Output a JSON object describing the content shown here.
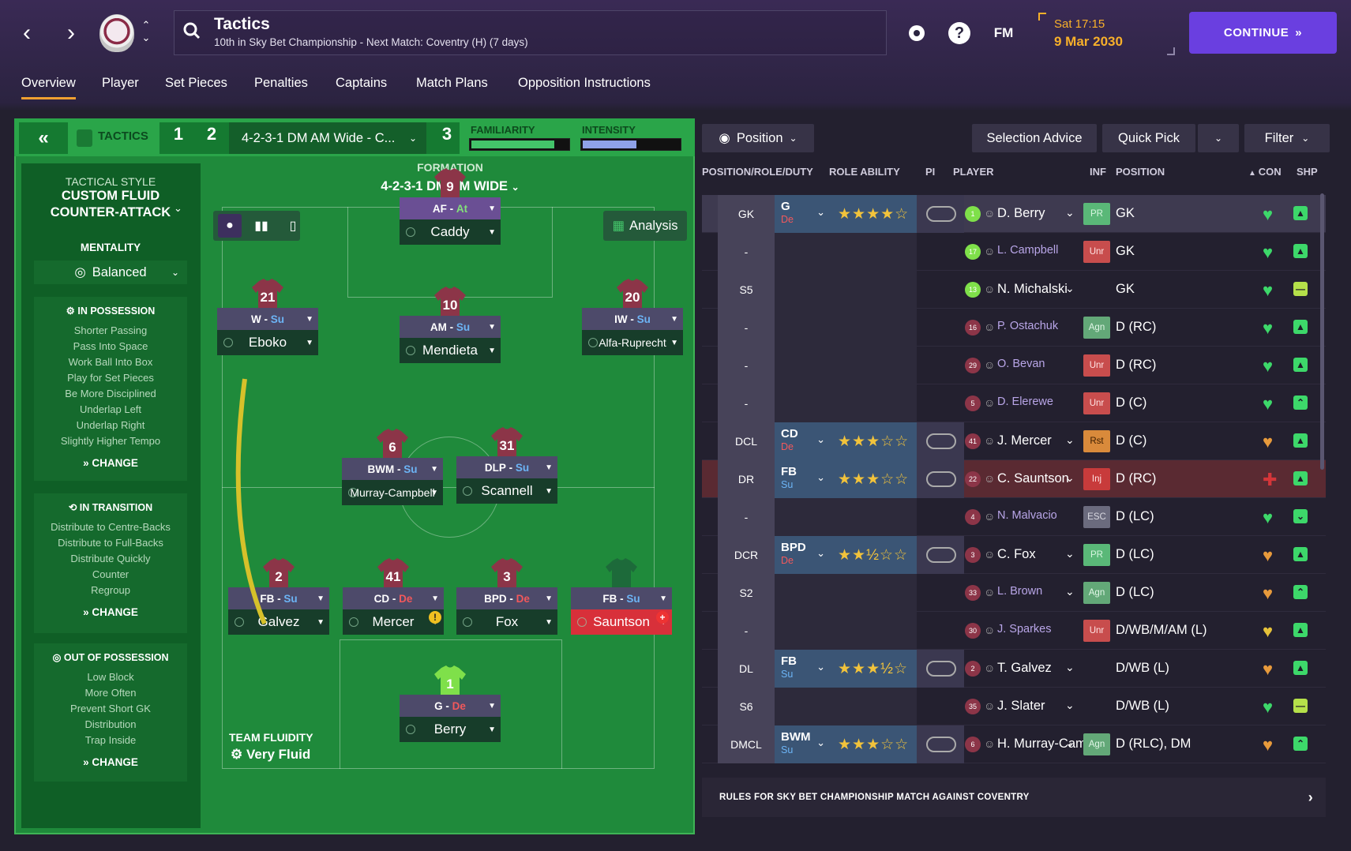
{
  "header": {
    "title": "Tactics",
    "subtitle": "10th in Sky Bet Championship - Next Match: Coventry (H) (7 days)",
    "fm_label": "FM",
    "time": "Sat 17:15",
    "date": "9 Mar 2030",
    "continue_label": "CONTINUE"
  },
  "tabs": [
    "Overview",
    "Player",
    "Set Pieces",
    "Penalties",
    "Captains",
    "Match Plans",
    "Opposition Instructions"
  ],
  "tactics_bar": {
    "label": "TACTICS",
    "slot1": "1",
    "slot2": "2",
    "slot3": "3",
    "formation_select": "4-2-3-1 DM AM Wide - C...",
    "familiarity_label": "FAMILIARITY",
    "intensity_label": "INTENSITY",
    "familiarity": 0.85,
    "intensity": 0.55
  },
  "sidebar": {
    "style_label": "TACTICAL STYLE",
    "style_value_1": "CUSTOM FLUID",
    "style_value_2": "COUNTER-ATTACK",
    "mentality_label": "MENTALITY",
    "mentality_value": "Balanced",
    "in_possession": {
      "title": "IN POSSESSION",
      "items": [
        "Shorter Passing",
        "Pass Into Space",
        "Work Ball Into Box",
        "Play for Set Pieces",
        "Be More Disciplined",
        "Underlap Left",
        "Underlap Right",
        "Slightly Higher Tempo"
      ],
      "change": "CHANGE"
    },
    "in_transition": {
      "title": "IN TRANSITION",
      "items": [
        "Distribute to Centre-Backs",
        "Distribute to Full-Backs",
        "Distribute Quickly",
        "Counter",
        "Regroup"
      ],
      "change": "CHANGE"
    },
    "out_of_possession": {
      "title": "OUT OF POSSESSION",
      "items": [
        "Low Block",
        "More Often",
        "Prevent Short GK",
        "Distribution",
        "Trap Inside"
      ],
      "change": "CHANGE"
    }
  },
  "pitch": {
    "formation_label": "FORMATION",
    "formation_value": "4-2-3-1 DM AM WIDE",
    "analysis_label": "Analysis",
    "fluidity_label": "TEAM FLUIDITY",
    "fluidity_value": "Very Fluid",
    "players": [
      {
        "id": "af",
        "num": "9",
        "role": "AF",
        "duty": "At",
        "name": "Caddy"
      },
      {
        "id": "w",
        "num": "21",
        "role": "W",
        "duty": "Su",
        "name": "Eboko"
      },
      {
        "id": "am",
        "num": "10",
        "role": "AM",
        "duty": "Su",
        "name": "Mendieta"
      },
      {
        "id": "iw",
        "num": "20",
        "role": "IW",
        "duty": "Su",
        "name": "Alfa-Ruprecht"
      },
      {
        "id": "bwm",
        "num": "6",
        "role": "BWM",
        "duty": "Su",
        "name": "Murray-Campbell"
      },
      {
        "id": "dlp",
        "num": "31",
        "role": "DLP",
        "duty": "Su",
        "name": "Scannell"
      },
      {
        "id": "fbl",
        "num": "2",
        "role": "FB",
        "duty": "Su",
        "name": "Galvez"
      },
      {
        "id": "cd",
        "num": "41",
        "role": "CD",
        "duty": "De",
        "name": "Mercer"
      },
      {
        "id": "bpd",
        "num": "3",
        "role": "BPD",
        "duty": "De",
        "name": "Fox"
      },
      {
        "id": "fbr",
        "num": "",
        "role": "FB",
        "duty": "Su",
        "name": "Sauntson"
      },
      {
        "id": "gk",
        "num": "1",
        "role": "G",
        "duty": "De",
        "name": "Berry"
      }
    ]
  },
  "list": {
    "position_filter": "Position",
    "selection_advice": "Selection Advice",
    "quick_pick": "Quick Pick",
    "filter": "Filter",
    "columns": {
      "pos_role_duty": "POSITION/ROLE/DUTY",
      "role_ability": "ROLE ABILITY",
      "pi": "PI",
      "player": "PLAYER",
      "inf": "INF",
      "position": "POSITION",
      "con": "CON",
      "shp": "SHP"
    },
    "rows": [
      {
        "slot": "GK",
        "role": "G",
        "duty": "De",
        "stars": "★★★★☆",
        "num": "1",
        "player": "D. Berry",
        "inf": "PR",
        "position": "GK",
        "heart": "green",
        "shp": "up"
      },
      {
        "slot": "-",
        "role": "",
        "duty": "",
        "stars": "",
        "num": "17",
        "player": "L. Campbell",
        "inf": "Unr",
        "position": "GK",
        "heart": "green",
        "shp": "up"
      },
      {
        "slot": "S5",
        "role": "",
        "duty": "",
        "stars": "",
        "num": "13",
        "player": "N. Michalski",
        "inf": "",
        "position": "GK",
        "heart": "green",
        "shp": "flat"
      },
      {
        "slot": "-",
        "role": "",
        "duty": "",
        "stars": "",
        "num": "16",
        "player": "P. Ostachuk",
        "inf": "Agn",
        "position": "D (RC)",
        "heart": "green",
        "shp": "up"
      },
      {
        "slot": "-",
        "role": "",
        "duty": "",
        "stars": "",
        "num": "29",
        "player": "O. Bevan",
        "inf": "Unr",
        "position": "D (RC)",
        "heart": "green",
        "shp": "up"
      },
      {
        "slot": "-",
        "role": "",
        "duty": "",
        "stars": "",
        "num": "5",
        "player": "D. Elerewe",
        "inf": "Unr",
        "position": "D (C)",
        "heart": "green",
        "shp": "up2"
      },
      {
        "slot": "DCL",
        "role": "CD",
        "duty": "De",
        "stars": "★★★☆☆",
        "num": "41",
        "player": "J. Mercer",
        "inf": "Rst",
        "position": "D (C)",
        "heart": "orange",
        "shp": "up"
      },
      {
        "slot": "DR",
        "role": "FB",
        "duty": "Su",
        "stars": "★★★☆☆",
        "num": "22",
        "player": "C. Sauntson",
        "inf": "Inj",
        "position": "D (RC)",
        "heart": "red",
        "shp": "up"
      },
      {
        "slot": "-",
        "role": "",
        "duty": "",
        "stars": "",
        "num": "4",
        "player": "N. Malvacio",
        "inf": "ESC",
        "position": "D (LC)",
        "heart": "green",
        "shp": "down"
      },
      {
        "slot": "DCR",
        "role": "BPD",
        "duty": "De",
        "stars": "★★½☆☆",
        "num": "3",
        "player": "C. Fox",
        "inf": "PR",
        "position": "D (LC)",
        "heart": "orange",
        "shp": "up"
      },
      {
        "slot": "S2",
        "role": "",
        "duty": "",
        "stars": "",
        "num": "33",
        "player": "L. Brown",
        "inf": "Agn",
        "position": "D (LC)",
        "heart": "orange",
        "shp": "up2"
      },
      {
        "slot": "-",
        "role": "",
        "duty": "",
        "stars": "",
        "num": "30",
        "player": "J. Sparkes",
        "inf": "Unr",
        "position": "D/WB/M/AM (L)",
        "heart": "yellow",
        "shp": "up"
      },
      {
        "slot": "DL",
        "role": "FB",
        "duty": "Su",
        "stars": "★★★½☆",
        "num": "2",
        "player": "T. Galvez",
        "inf": "",
        "position": "D/WB (L)",
        "heart": "orange",
        "shp": "up"
      },
      {
        "slot": "S6",
        "role": "",
        "duty": "",
        "stars": "",
        "num": "35",
        "player": "J. Slater",
        "inf": "",
        "position": "D/WB (L)",
        "heart": "green",
        "shp": "flat"
      },
      {
        "slot": "DMCL",
        "role": "BWM",
        "duty": "Su",
        "stars": "★★★☆☆",
        "num": "6",
        "player": "H. Murray-Camp...",
        "inf": "Agn",
        "position": "D (RLC), DM",
        "heart": "orange",
        "shp": "up2"
      }
    ],
    "footer": "RULES FOR SKY BET CHAMPIONSHIP MATCH AGAINST COVENTRY"
  }
}
